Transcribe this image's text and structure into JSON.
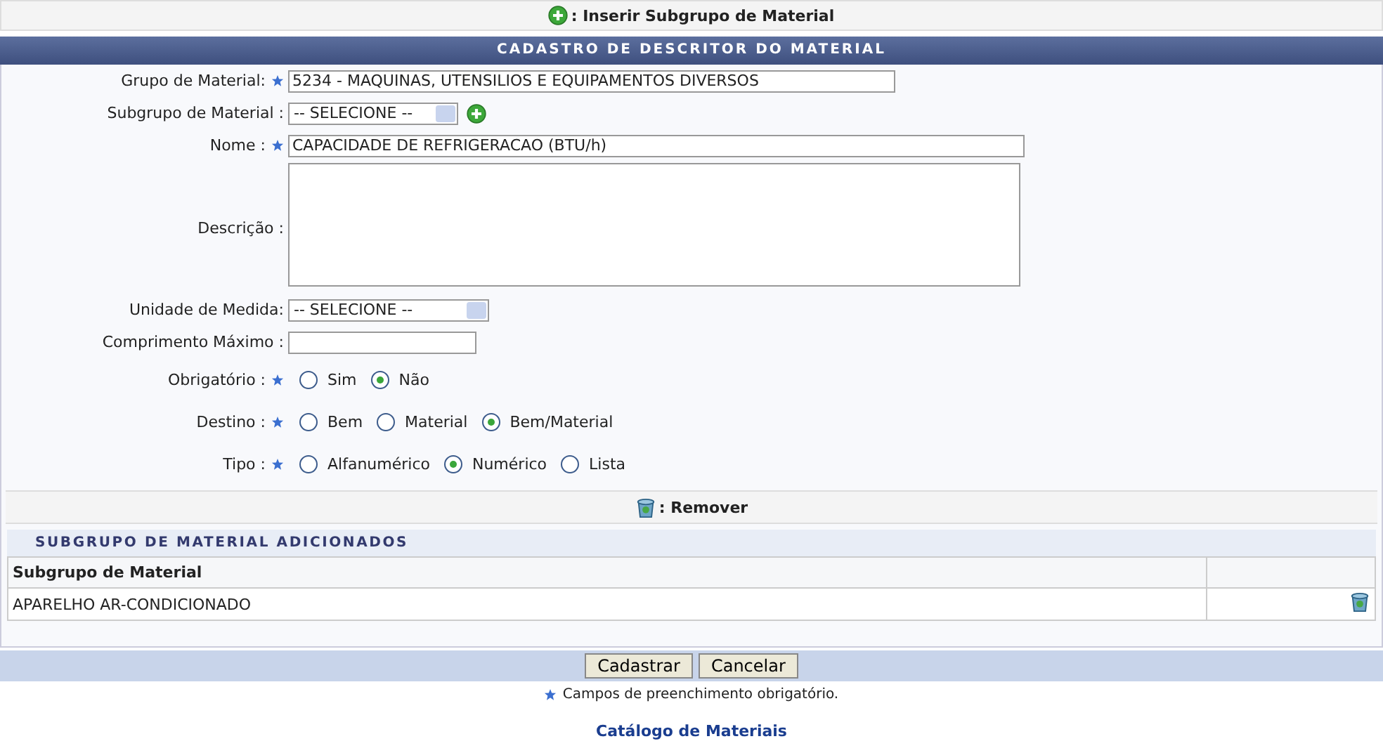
{
  "top_action": {
    "label": ": Inserir Subgrupo de Material"
  },
  "form": {
    "title": "CADASTRO DE DESCRITOR DO MATERIAL",
    "fields": [
      {
        "kind": "text",
        "label": "Grupo de Material:",
        "required": true,
        "value": "5234 - MAQUINAS, UTENSILIOS E EQUIPAMENTOS DIVERSOS"
      },
      {
        "kind": "select",
        "label": "Subgrupo de Material :",
        "required": false,
        "value": "-- SELECIONE --",
        "add": true
      },
      {
        "kind": "text",
        "label": "Nome :",
        "required": true,
        "value": "CAPACIDADE DE REFRIGERACAO (BTU/h)"
      },
      {
        "kind": "textarea",
        "label": "Descrição :",
        "required": false
      },
      {
        "kind": "select",
        "label": "Unidade de Medida:",
        "required": false,
        "value": "-- SELECIONE --",
        "add": false
      },
      {
        "kind": "text",
        "label": "Comprimento Máximo :",
        "required": false
      },
      {
        "kind": "radio",
        "label": "Obrigatório :",
        "required": true,
        "options": [
          {
            "label": "Sim",
            "selected": false
          },
          {
            "label": "Não",
            "selected": true
          }
        ]
      },
      {
        "kind": "radio",
        "label": "Destino :",
        "required": true,
        "options": [
          {
            "label": "Bem",
            "selected": false
          },
          {
            "label": "Material",
            "selected": false
          },
          {
            "label": "Bem/Material",
            "selected": true
          }
        ]
      },
      {
        "kind": "radio",
        "label": "Tipo :",
        "required": true,
        "options": [
          {
            "label": "Alfanumérico",
            "selected": false
          },
          {
            "label": "Numérico",
            "selected": true
          },
          {
            "label": "Lista",
            "selected": false
          }
        ]
      }
    ],
    "remove_legend": ": Remover",
    "subtable": {
      "title": "SUBGRUPO DE MATERIAL ADICIONADOS",
      "columns": [
        "Subgrupo de Material"
      ],
      "rows": [
        {
          "name": "APARELHO AR-CONDICIONADO"
        }
      ]
    },
    "buttons": [
      "Cadastrar",
      "Cancelar"
    ]
  },
  "required_note": "Campos de preenchimento obrigatório.",
  "footer_link": "Catálogo de Materiais"
}
